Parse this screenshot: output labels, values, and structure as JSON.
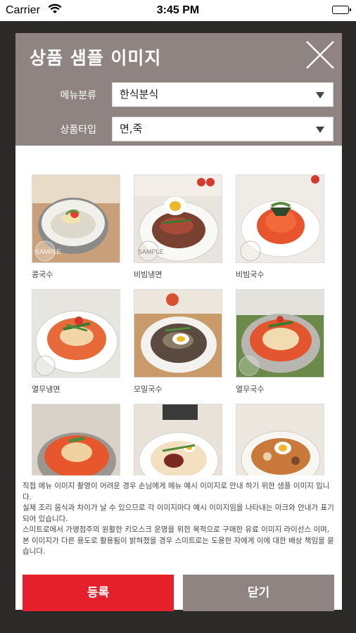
{
  "status_bar": {
    "carrier": "Carrier",
    "time": "3:45 PM"
  },
  "modal": {
    "title": "상품 샘플 이미지",
    "menu_category": {
      "label": "메뉴분류",
      "value": "한식분식"
    },
    "product_type": {
      "label": "상품타입",
      "value": "면,죽"
    }
  },
  "items": [
    {
      "name": "콩국수"
    },
    {
      "name": "비빔냉면"
    },
    {
      "name": "비빔국수"
    },
    {
      "name": "열무냉면"
    },
    {
      "name": "모밀국수"
    },
    {
      "name": "열무국수"
    },
    {
      "name": ""
    },
    {
      "name": ""
    },
    {
      "name": ""
    }
  ],
  "sample_badge": "SAMPLE",
  "notice": {
    "line1": "직접 메뉴 이미지 촬영이 어려운 경우 손님에게 메뉴 예시 이미지로 안내 하기 위한 샘플 이미지 입니다.",
    "line2": "실제 조리 음식과 차이가 날 수 있으므로 각 이미지마다 예시 이미지임을 나타내는 마크와 안내가 표기되어 있습니다.",
    "line3": "스미트로에서 가맹점주의 원활한 키오스크 운영을 위한 목적으로 구매한 유료 이미지 라이선스 이며, 본 이미지가 다른 용도로 활용됨이 밝혀졌을 경우 스미트로는 도용한 자에게 이에 대한 배상 책임을 묻습니다."
  },
  "buttons": {
    "register": "등록",
    "close": "닫기"
  },
  "colors": {
    "header": "#8f8482",
    "register": "#e5202b",
    "close": "#8f8482"
  }
}
